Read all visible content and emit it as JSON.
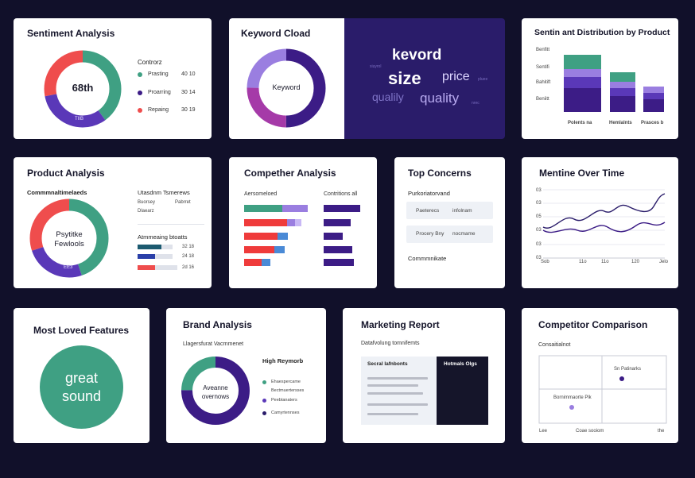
{
  "colors": {
    "bg": "#11102a",
    "green": "#3fa083",
    "purple": "#5a38b8",
    "darkpurple": "#3c1c86",
    "red": "#ef4d4d",
    "lavender": "#9a7ee0",
    "blue": "#4a8ad6",
    "magenta": "#a53aa8"
  },
  "sentiment": {
    "title": "Sentiment Analysis",
    "center": "68th",
    "segment_label": "TIIB",
    "legend_title": "Controrz",
    "legend": [
      {
        "label": "Prasting",
        "value": "40 10"
      },
      {
        "label": "Proarring",
        "value": "30 14"
      },
      {
        "label": "Repaing",
        "value": "30 19"
      }
    ]
  },
  "keyword": {
    "title": "Keyword Cload",
    "center": "Keyword",
    "words": [
      "kevord",
      "size",
      "price",
      "qualily",
      "quality",
      "xiuyrol",
      "pluee",
      "nrec"
    ]
  },
  "distribution": {
    "title": "Sentin ant Distribution by Product",
    "ylabels": [
      "Benfitt",
      "Sentifi",
      "Bahitift",
      "Beniitt"
    ],
    "categories": [
      "Polents na",
      "Hemlalnts",
      "Prasces b"
    ]
  },
  "product": {
    "title": "Product Analysis",
    "subtitle": "Commmnaltimelaeds",
    "center_line1": "Psytitke",
    "center_line2": "Fewlools",
    "segment_label": "EE3",
    "right_title": "Utasdnm Tsmerews",
    "right_items": [
      "Buorsey",
      "Pabrret",
      "Dlaearz"
    ],
    "bars_title": "Atmmeaing btoatts",
    "bars": [
      {
        "value": "32 18"
      },
      {
        "value": "24 18"
      },
      {
        "value": "2d 16"
      }
    ]
  },
  "compether": {
    "title": "Compether Analysis",
    "left_label": "Aersomeloed",
    "right_label": "Contritions all"
  },
  "concerns": {
    "title": "Top Concerns",
    "subtitle": "Purkoriatorvand",
    "rows": [
      {
        "left": "Paeterecs",
        "right": "infolnam"
      },
      {
        "left": "Procery Bny",
        "right": "nocmame"
      }
    ],
    "footer": "Commmnikate"
  },
  "mentions": {
    "title": "Mentine Over Time",
    "ylabels": [
      "03",
      "03",
      "05",
      "03",
      "03",
      "03"
    ],
    "xlabels": [
      "Sob",
      "11o",
      "11o",
      "120",
      "Jelo"
    ]
  },
  "loved": {
    "title": "Most Loved Features",
    "line1": "great",
    "line2": "sound"
  },
  "brand": {
    "title": "Brand Analysis",
    "subtitle": "Llagersfurat Vacrnmenet",
    "center_line1": "Aveanne",
    "center_line2": "overnows",
    "legend_title": "High Reymorb",
    "legend": [
      "Ehaespercame",
      "Bectmuertersses",
      "Peebtanaters",
      "Camyrtennses"
    ]
  },
  "marketing": {
    "title": "Marketing Report",
    "subtitle": "Datafvolung tomnifemts",
    "left_header": "Secral lafnbonts",
    "right_header": "Hotmals Olgs"
  },
  "comparison": {
    "title": "Competitor Comparison",
    "subtitle": "Consaitialnot",
    "point1": "Sn Patinarks",
    "point2": "Bornimmaorte Plk",
    "xlabels": [
      "Lee",
      "Coae sooiom",
      "the"
    ]
  }
}
